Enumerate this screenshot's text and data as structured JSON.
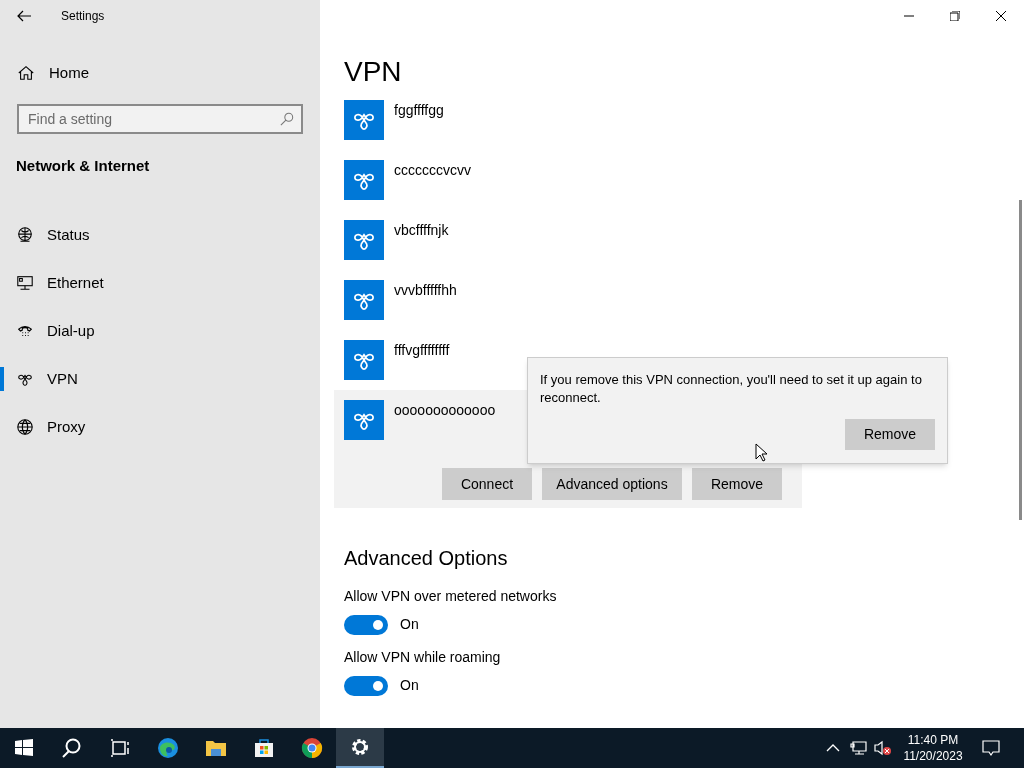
{
  "window": {
    "title": "Settings"
  },
  "sidebar": {
    "home": "Home",
    "search": {
      "placeholder": "Find a setting"
    },
    "section": "Network & Internet",
    "items": [
      {
        "kind": "status",
        "label": "Status",
        "selected": false
      },
      {
        "kind": "ethernet",
        "label": "Ethernet",
        "selected": false
      },
      {
        "kind": "dialup",
        "label": "Dial-up",
        "selected": false
      },
      {
        "kind": "vpn",
        "label": "VPN",
        "selected": true
      },
      {
        "kind": "proxy",
        "label": "Proxy",
        "selected": false
      }
    ]
  },
  "page": {
    "title": "VPN",
    "connections": [
      {
        "name": "fggffffgg",
        "selected": false
      },
      {
        "name": "cccccccvcvv",
        "selected": false
      },
      {
        "name": "vbcffffnjk",
        "selected": false
      },
      {
        "name": "vvvbfffffhh",
        "selected": false
      },
      {
        "name": "fffvgffffffff",
        "selected": false
      },
      {
        "name": "ooooooooooooo",
        "selected": true
      }
    ],
    "actions": [
      "Connect",
      "Advanced options",
      "Remove"
    ],
    "advanced_title": "Advanced Options",
    "options": [
      {
        "label": "Allow VPN over metered networks",
        "on": true,
        "state": "On"
      },
      {
        "label": "Allow VPN while roaming",
        "on": true,
        "state": "On"
      }
    ]
  },
  "flyout": {
    "message": "If you remove this VPN connection, you'll need to set it up again to reconnect.",
    "button": "Remove"
  },
  "taskbar": {
    "apps": [
      {
        "kind": "start",
        "selected": false
      },
      {
        "kind": "search",
        "selected": false
      },
      {
        "kind": "taskview",
        "selected": false
      },
      {
        "kind": "edge",
        "selected": false
      },
      {
        "kind": "explorer",
        "selected": false
      },
      {
        "kind": "store",
        "selected": false
      },
      {
        "kind": "chrome",
        "selected": false
      },
      {
        "kind": "settings",
        "selected": true
      }
    ],
    "time": "11:40 PM",
    "date": "11/20/2023"
  }
}
